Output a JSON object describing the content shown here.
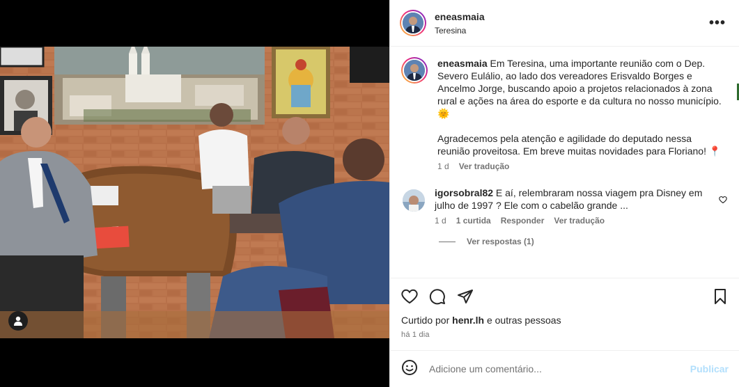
{
  "post": {
    "author": {
      "username": "eneasmaia",
      "location": "Teresina"
    },
    "caption": {
      "username": "eneasmaia",
      "text": "Em Teresina, uma importante reunião com o Dep. Severo Eulálio, ao lado dos vereadores Erisvaldo Borges e Ancelmo Jorge, buscando apoio a projetos relacionados à zona rural e ações na área do esporte e da cultura no nosso município. 🌞\n\nAgradecemos pela atenção e agilidade do deputado nessa reunião proveitosa. Em breve muitas novidades para Floriano! 📍",
      "age": "1 d",
      "translate_label": "Ver tradução"
    },
    "comments": [
      {
        "username": "igorsobral82",
        "text": "E aí, relembraram nossa viagem pra Disney em julho de 1997 ? Ele com o cabelão grande ...",
        "age": "1 d",
        "likes_label": "1 curtida",
        "reply_label": "Responder",
        "translate_label": "Ver tradução",
        "replies_label": "Ver respostas (1)"
      }
    ],
    "likes": {
      "prefix": "Curtido por ",
      "user": "henr.lh",
      "suffix": " e outras pessoas"
    },
    "timestamp": "há 1 dia",
    "comment_input": {
      "placeholder": "Adicione um comentário..."
    },
    "publish_label": "Publicar"
  },
  "icons": {
    "more": "more-options-icon",
    "like": "heart-icon",
    "comment": "comment-icon",
    "share": "share-icon",
    "save": "bookmark-icon",
    "emoji": "emoji-icon",
    "tags": "user-tag-icon"
  }
}
